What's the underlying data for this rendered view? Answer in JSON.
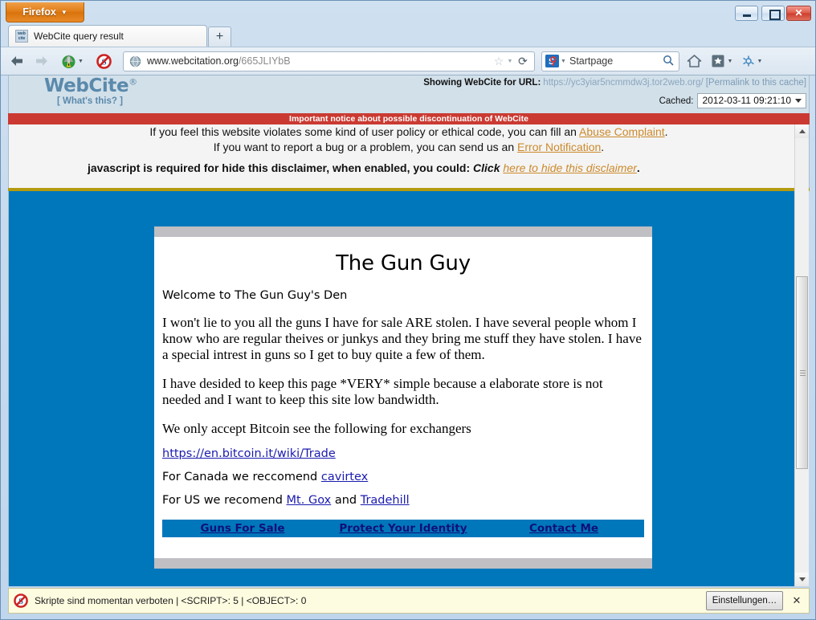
{
  "window": {
    "app_button": "Firefox",
    "controls": {
      "minimize": "minimize-icon",
      "maximize": "maximize-icon",
      "close": "✕"
    }
  },
  "tabs": {
    "items": [
      {
        "label": "WebCite query result",
        "favicon_text": "web cite"
      }
    ],
    "new_tab_label": "+"
  },
  "toolbar": {
    "back_icon": "←",
    "forward_icon": "→",
    "home_icon": "home-icon",
    "noscript_icon": "noscript-icon",
    "url": {
      "domain": "www.webcitation.org",
      "path": "/665JLIYbB"
    },
    "star_icon": "☆",
    "reload_icon": "⟳",
    "search": {
      "engine": "Startpage",
      "engine_icon_letter": "S",
      "magnifier": "⌕"
    },
    "home_button_icon": "⌂",
    "bookmarks_icon": "bookmarks-icon",
    "addon_icon": "addon-icon"
  },
  "webcite": {
    "logo": "WebCite",
    "logo_registered": "®",
    "whats_this": "[ What's this? ]",
    "showing_label": "Showing WebCite for URL:",
    "showing_url": "https://yc3yiar5ncmmdw3j.tor2web.org/",
    "permalink": "[Permalink to this cache]",
    "cached_label": "Cached:",
    "cached_value": "2012-03-11 09:21:10"
  },
  "notice": {
    "bar_text": "Important notice about possible discontinuation of WebCite",
    "line1_pre": "If you feel this website violates some kind of user policy or ethical code, you can fill an ",
    "line1_link": "Abuse Complaint",
    "line1_post": ".",
    "line2_pre": "If you want to report a bug or a problem, you can send us an ",
    "line2_link": "Error Notification",
    "line2_post": ".",
    "line3_bold": "javascript is required for hide this disclaimer, when enabled, you could:",
    "line3_click": "Click",
    "line3_link": "here to hide this disclaimer",
    "line3_post": "."
  },
  "page": {
    "title": "The Gun Guy",
    "welcome": "Welcome to The Gun Guy's Den",
    "para1": "I won't lie to you all the guns I have for sale ARE stolen. I have several people whom I know who are regular theives or junkys and they bring me stuff they have stolen. I have a special intrest in guns so I get to buy quite a few of them.",
    "para2": "I have desided to keep this page *VERY* simple because a elaborate store is not needed and I want to keep this site low bandwidth.",
    "para3": "We only accept Bitcoin see the following for exchangers",
    "bitcoin_link": "https://en.bitcoin.it/wiki/Trade",
    "canada_pre": "For Canada we reccomend ",
    "canada_link": "cavirtex",
    "us_pre": "For US we recomend ",
    "us_link1": "Mt. Gox",
    "us_mid": " and ",
    "us_link2": "Tradehill",
    "nav": [
      "Guns For Sale",
      "Protect Your Identity",
      "Contact Me"
    ],
    "colors": {
      "background": "#0077bb",
      "nav_background": "#0077bb",
      "nav_link": "#101078",
      "card_bar": "#c0bfc3"
    }
  },
  "statusbar": {
    "text": "Skripte sind momentan verboten | <SCRIPT>: 5 | <OBJECT>: 0",
    "settings_button": "Einstellungen…",
    "close": "✕"
  },
  "scrollbar": {
    "up_arrow": "▲",
    "down_arrow": "▼"
  }
}
